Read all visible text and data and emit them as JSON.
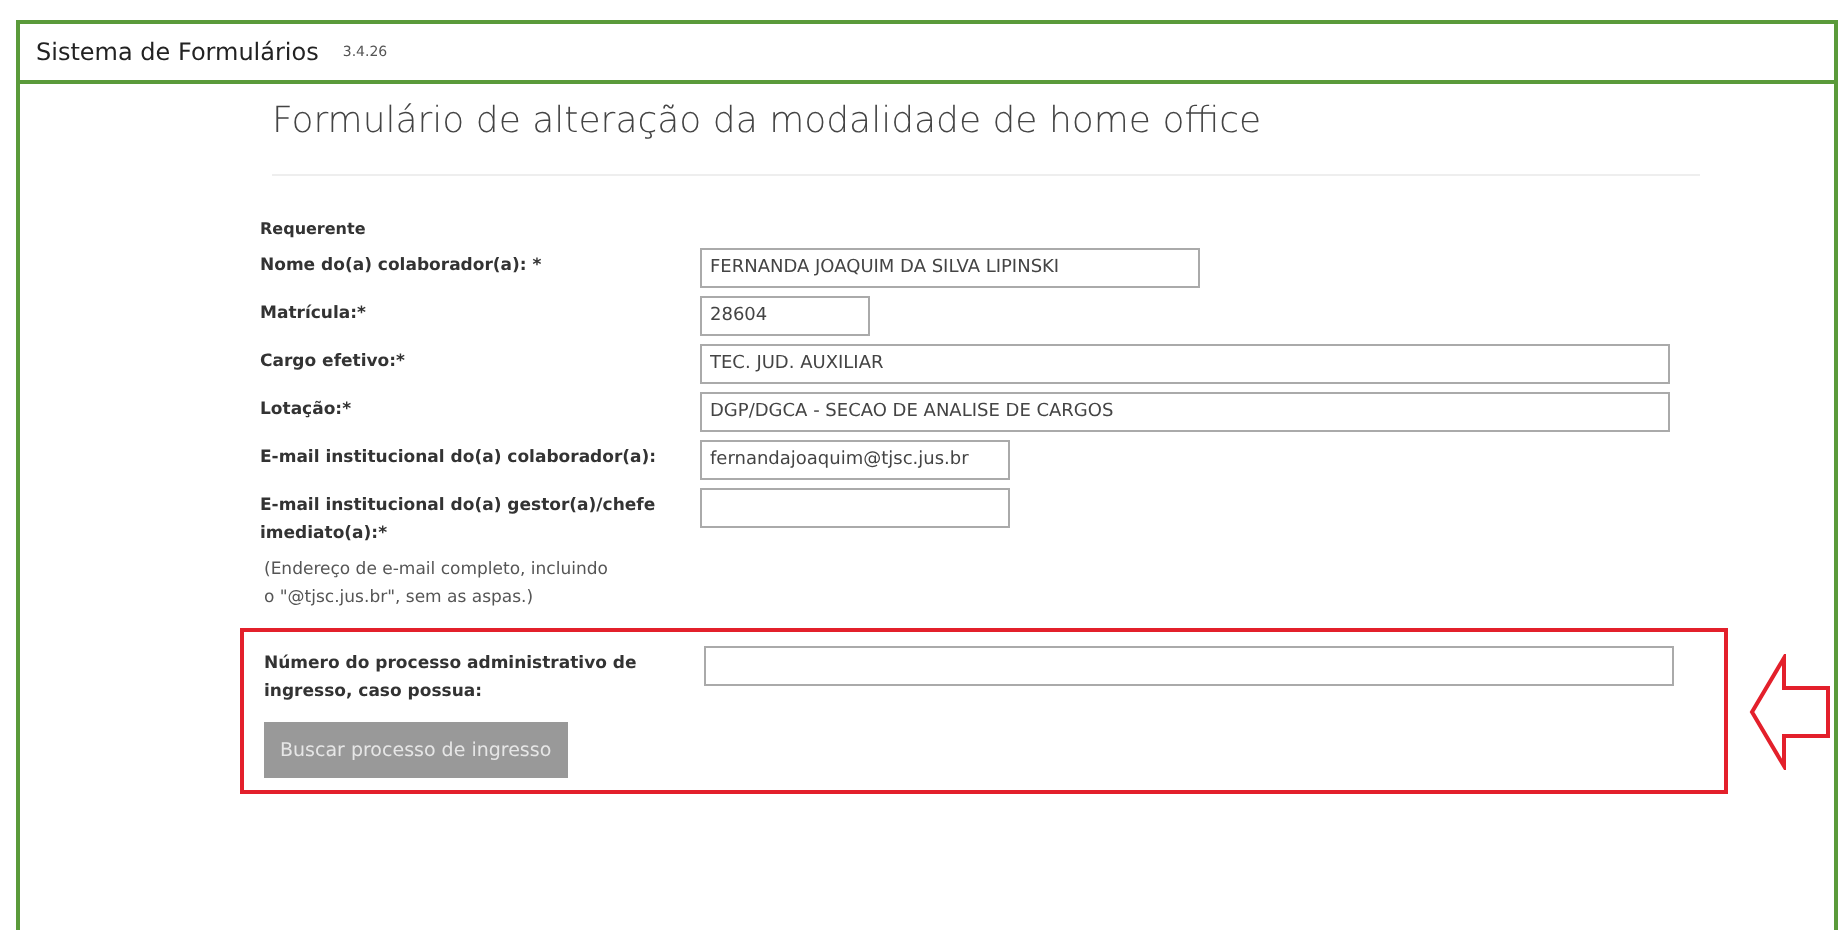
{
  "header": {
    "title": "Sistema de Formulários",
    "version": "3.4.26"
  },
  "form": {
    "title": "Formulário de alteração da modalidade de home office",
    "section_label": "Requerente",
    "fields": [
      {
        "label": "Nome do(a) colaborador(a): *",
        "value": "FERNANDA JOAQUIM DA SILVA LIPINSKI"
      },
      {
        "label": "Matrícula:*",
        "value": "28604"
      },
      {
        "label": "Cargo efetivo:*",
        "value": "TEC. JUD. AUXILIAR"
      },
      {
        "label": "Lotação:*",
        "value": "DGP/DGCA - SECAO DE ANALISE DE CARGOS"
      },
      {
        "label": "E-mail institucional do(a) colaborador(a):",
        "value": "fernandajoaquim@tjsc.jus.br"
      },
      {
        "label": "E-mail institucional do(a) gestor(a)/chefe imediato(a):*"
      }
    ],
    "hint": "(Endereço de e-mail completo, incluindo o \"@tjsc.jus.br\", sem as aspas.)",
    "highlight": {
      "field": {
        "label": "Número do processo administrativo de ingresso, caso possua:"
      },
      "button": {
        "label": "Buscar processo de ingresso",
        "disabled": true
      }
    }
  }
}
